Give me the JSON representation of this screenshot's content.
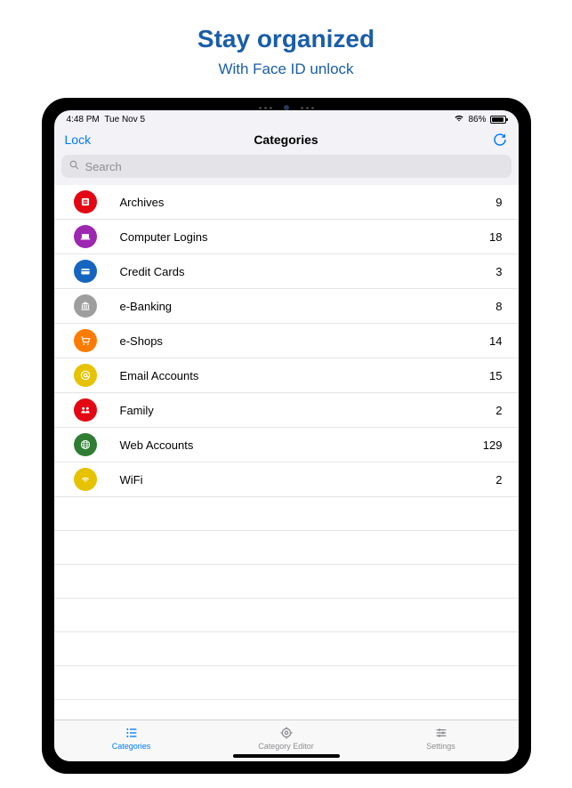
{
  "promo": {
    "title": "Stay organized",
    "subtitle": "With Face ID unlock"
  },
  "status": {
    "time": "4:48 PM",
    "date": "Tue Nov 5",
    "battery": "86%"
  },
  "nav": {
    "lock": "Lock",
    "title": "Categories"
  },
  "search": {
    "placeholder": "Search"
  },
  "categories": [
    {
      "icon": "archive",
      "label": "Archives",
      "count": "9",
      "bg": "#e30613"
    },
    {
      "icon": "laptop",
      "label": "Computer Logins",
      "count": "18",
      "bg": "#9c27b0"
    },
    {
      "icon": "card",
      "label": "Credit Cards",
      "count": "3",
      "bg": "#1565c0"
    },
    {
      "icon": "bank",
      "label": "e-Banking",
      "count": "8",
      "bg": "#9e9e9e"
    },
    {
      "icon": "cart",
      "label": "e-Shops",
      "count": "14",
      "bg": "#ff7a00"
    },
    {
      "icon": "at",
      "label": "Email Accounts",
      "count": "15",
      "bg": "#e6c200"
    },
    {
      "icon": "family",
      "label": "Family",
      "count": "2",
      "bg": "#e30613"
    },
    {
      "icon": "globe",
      "label": "Web Accounts",
      "count": "129",
      "bg": "#2e7d32"
    },
    {
      "icon": "wifi",
      "label": "WiFi",
      "count": "2",
      "bg": "#e6c200"
    }
  ],
  "tabs": [
    {
      "label": "Categories",
      "icon": "list",
      "active": true
    },
    {
      "label": "Category Editor",
      "icon": "gear",
      "active": false
    },
    {
      "label": "Settings",
      "icon": "sliders",
      "active": false
    }
  ]
}
